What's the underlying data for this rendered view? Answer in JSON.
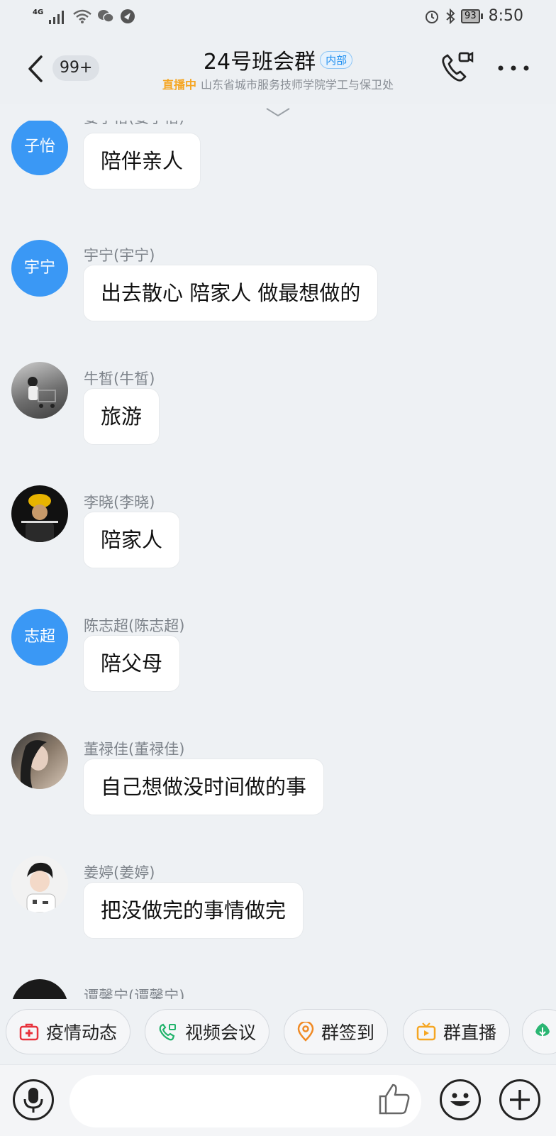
{
  "status_bar": {
    "network": "4G",
    "battery": "93",
    "time": "8:50",
    "icons": [
      "signal-icon",
      "wifi-icon",
      "wechat-icon",
      "app-icon",
      "alarm-icon",
      "bluetooth-icon",
      "battery-icon"
    ]
  },
  "header": {
    "unread_count": "99+",
    "group_name": "24号班会群",
    "tag": "内部",
    "live_label": "直播中",
    "subtitle": "山东省城市服务技师学院学工与保卫处"
  },
  "messages": [
    {
      "sender": "姜子怡(姜子怡)",
      "avatar_text": "子怡",
      "avatar_type": "text",
      "text": "陪伴亲人"
    },
    {
      "sender": "宇宁(宇宁)",
      "avatar_text": "宇宁",
      "avatar_type": "text",
      "text": "出去散心 陪家人 做最想做的"
    },
    {
      "sender": "牛皙(牛皙)",
      "avatar_text": "",
      "avatar_type": "photo",
      "text": "旅游"
    },
    {
      "sender": "李晓(李晓)",
      "avatar_text": "",
      "avatar_type": "photo",
      "text": "陪家人"
    },
    {
      "sender": "陈志超(陈志超)",
      "avatar_text": "志超",
      "avatar_type": "text",
      "text": "陪父母"
    },
    {
      "sender": "董禄佳(董禄佳)",
      "avatar_text": "",
      "avatar_type": "photo",
      "text": "自己想做没时间做的事"
    },
    {
      "sender": "姜婷(姜婷)",
      "avatar_text": "",
      "avatar_type": "photo",
      "text": "把没做完的事情做完"
    },
    {
      "sender": "谭馨宁(谭馨宁)",
      "avatar_text": "",
      "avatar_type": "photo",
      "text": ""
    }
  ],
  "quick_actions": [
    {
      "label": "疫情动态",
      "icon": "medical-kit-icon",
      "color": "#e8323c"
    },
    {
      "label": "视频会议",
      "icon": "video-call-icon",
      "color": "#21b36b"
    },
    {
      "label": "群签到",
      "icon": "location-pin-icon",
      "color": "#f08a24"
    },
    {
      "label": "群直播",
      "icon": "tv-live-icon",
      "color": "#f5a623"
    },
    {
      "label": "",
      "icon": "tree-icon",
      "color": "#2bb673"
    }
  ],
  "input_bar": {
    "icons": [
      "microphone-icon",
      "thumbs-up-icon",
      "emoji-icon",
      "plus-icon"
    ]
  },
  "colors": {
    "accent": "#3a98f5",
    "background": "#eef1f4",
    "live": "#f5a623"
  }
}
